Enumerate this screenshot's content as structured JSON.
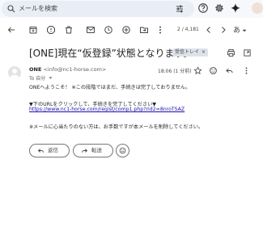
{
  "search": {
    "placeholder": "メールを検索"
  },
  "toolbar": {
    "pager": "2 / 4,181",
    "lang": "あ"
  },
  "message": {
    "subject": "[ONE]現在“仮登録”状態となります。",
    "label": "受信トレイ",
    "label_close": "×",
    "sender_name": "ONE",
    "sender_email": "<info@nc1-horse.com>",
    "to": "To 自分",
    "time": "18:06 (1 分前)",
    "body": {
      "line1": "ONEへようこそ！ ※この段階ではまだ、手続きは完了しておりません。",
      "line2": "▼下のURLをクリックして、手続きを完了してください▼",
      "link": "https://www.nc1-horse.com/regist/comp1.php?rid2=8nroTSAZ",
      "line3": "※メールに心当たりのない方は、お手数ですが本メールを削除してください。"
    }
  },
  "actions": {
    "reply": "返信",
    "forward": "転送"
  }
}
